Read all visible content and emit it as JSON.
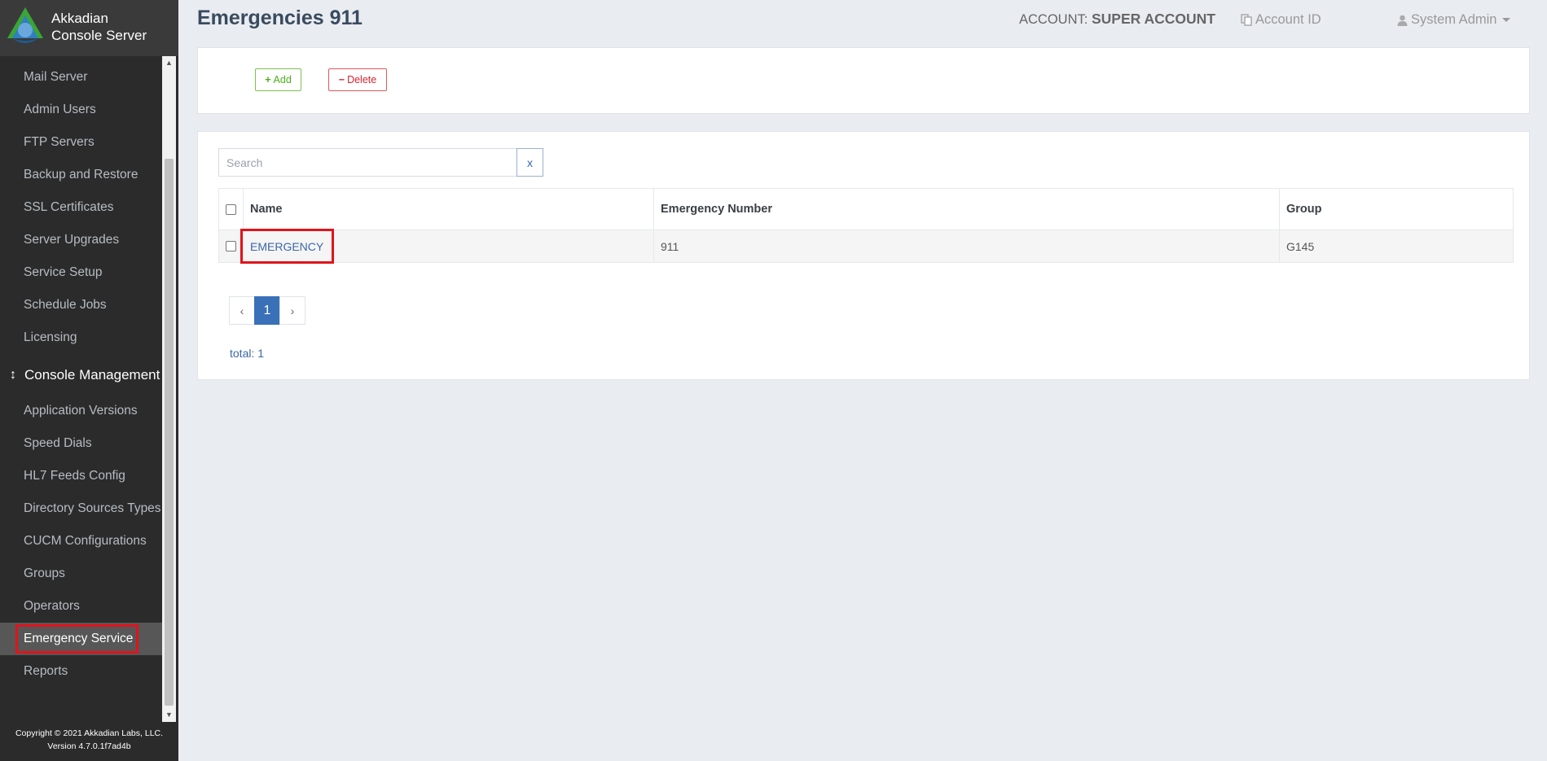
{
  "brand": {
    "line1": "Akkadian",
    "line2": "Console Server"
  },
  "header": {
    "title": "Emergencies 911",
    "account_label": "ACCOUNT:",
    "account_value": "SUPER ACCOUNT",
    "account_id": "Account ID",
    "user": "System Admin"
  },
  "sidebar": {
    "items": [
      {
        "label": "Mail Server"
      },
      {
        "label": "Admin Users"
      },
      {
        "label": "FTP Servers"
      },
      {
        "label": "Backup and Restore"
      },
      {
        "label": "SSL Certificates"
      },
      {
        "label": "Server Upgrades"
      },
      {
        "label": "Service Setup"
      },
      {
        "label": "Schedule Jobs"
      },
      {
        "label": "Licensing"
      }
    ],
    "section": "Console Management",
    "section_items": [
      {
        "label": "Application Versions"
      },
      {
        "label": "Speed Dials"
      },
      {
        "label": "HL7 Feeds Config"
      },
      {
        "label": "Directory Sources Types"
      },
      {
        "label": "CUCM Configurations"
      },
      {
        "label": "Groups"
      },
      {
        "label": "Operators"
      },
      {
        "label": "Emergency Service",
        "active": true
      },
      {
        "label": "Reports"
      }
    ],
    "footer_copyright": "Copyright © 2021 Akkadian Labs, LLC.",
    "footer_version": "Version 4.7.0.1f7ad4b"
  },
  "toolbar": {
    "add_label": "Add",
    "delete_label": "Delete"
  },
  "search": {
    "placeholder": "Search",
    "clear_label": "x"
  },
  "table": {
    "columns": [
      "Name",
      "Emergency Number",
      "Group"
    ],
    "rows": [
      {
        "name": "EMERGENCY",
        "number": "911",
        "group": "G145"
      }
    ]
  },
  "pagination": {
    "prev": "‹",
    "current": "1",
    "next": "›"
  },
  "total_text": "total: 1",
  "colors": {
    "accent": "#3a70b8",
    "highlight": "#e0141c",
    "add": "#4caf1d",
    "delete": "#d9232d"
  }
}
